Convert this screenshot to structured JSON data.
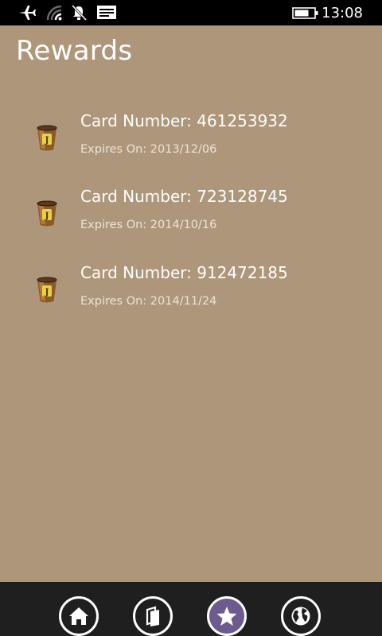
{
  "status_bar": {
    "time": "13:08",
    "icons": [
      "airplane-mode-icon",
      "wifi-icon",
      "quiet-hours-icon",
      "message-icon",
      "battery-icon"
    ]
  },
  "page": {
    "title": "Rewards"
  },
  "cards": [
    {
      "number": "Card Number: 461253932",
      "expires": "Expires On: 2013/12/06",
      "icon": "coffee-cup-icon"
    },
    {
      "number": "Card Number: 723128745",
      "expires": "Expires On: 2014/10/16",
      "icon": "coffee-cup-icon"
    },
    {
      "number": "Card Number: 912472185",
      "expires": "Expires On: 2014/11/24",
      "icon": "coffee-cup-icon"
    }
  ],
  "app_bar": {
    "buttons": [
      {
        "icon": "home-icon",
        "active": false
      },
      {
        "icon": "menu-cards-icon",
        "active": false
      },
      {
        "icon": "star-icon",
        "active": true
      },
      {
        "icon": "globe-icon",
        "active": false
      }
    ],
    "active_color": "#6d5a8e"
  },
  "colors": {
    "background": "#ae967a",
    "status_bar": "#000000",
    "app_bar": "#1f1f1f"
  }
}
